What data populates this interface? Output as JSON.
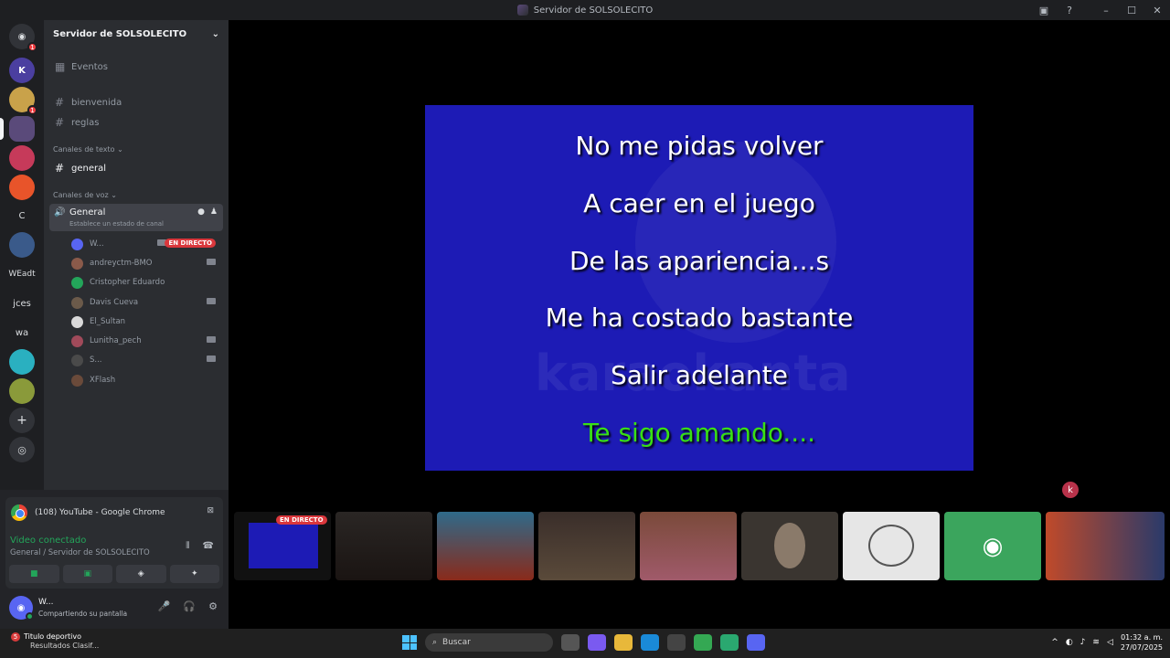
{
  "window": {
    "title": "Servidor de SOLSOLECITO"
  },
  "servers": [
    {
      "label": "",
      "badge": "1"
    },
    {
      "label": "K",
      "badge": ""
    },
    {
      "label": "",
      "badge": "1"
    },
    {
      "label": "",
      "badge": ""
    },
    {
      "label": "",
      "badge": ""
    },
    {
      "label": "",
      "badge": ""
    },
    {
      "label": "C",
      "badge": ""
    },
    {
      "label": "",
      "badge": ""
    },
    {
      "label": "WEadt",
      "badge": ""
    },
    {
      "label": "jces",
      "badge": ""
    },
    {
      "label": "wa",
      "badge": ""
    }
  ],
  "sidebar": {
    "server_name": "Servidor de SOLSOLECITO",
    "events": "Eventos",
    "channels": [
      "bienvenida",
      "reglas"
    ],
    "text_category": "Canales de texto",
    "text_channels": [
      "general"
    ],
    "voice_category": "Canales de voz",
    "voice_channel": {
      "name": "General",
      "status": "Establece un estado de canal"
    },
    "members": [
      {
        "name": "W...",
        "live": "EN DIRECTO",
        "color": "#5865f2"
      },
      {
        "name": "andreyctm-BMO",
        "color": "#8a5a4a"
      },
      {
        "name": "Cristopher Eduardo",
        "color": "#23a55a"
      },
      {
        "name": "Davis Cueva",
        "color": "#6b5a4a"
      },
      {
        "name": "El_Sultan",
        "color": "#d9d9d9"
      },
      {
        "name": "Lunitha_pech",
        "color": "#a04a5a"
      },
      {
        "name": "S...",
        "color": "#4a4a4a"
      },
      {
        "name": "XFlash",
        "color": "#6a4a3a"
      }
    ]
  },
  "stream_card": {
    "title": "(108) YouTube - Google Chrome",
    "status": "Video conectado",
    "location": "General / Servidor de SOLSOLECITO"
  },
  "user": {
    "name": "W...",
    "status": "Compartiendo su pantalla"
  },
  "karaoke": {
    "lines": [
      "No me pidas volver",
      "A caer en el juego",
      "De las apariencia...s",
      "Me ha costado bastante",
      "Salir adelante",
      "Te sigo amando...."
    ],
    "highlight_color": "#39e014",
    "background": "#1d1bb5"
  },
  "tiles": {
    "live_badge": "EN DIRECTO"
  },
  "taskbar": {
    "news_title": "Titulo deportivo",
    "news_sub": "Resultados Clasif...",
    "news_badge": "5",
    "search_placeholder": "Buscar",
    "time": "01:32 a. m.",
    "date": "27/07/2025"
  }
}
